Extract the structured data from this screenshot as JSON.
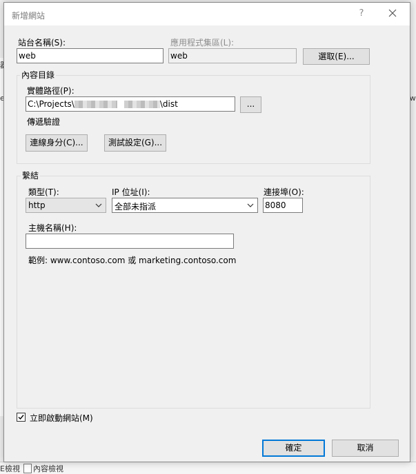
{
  "background": {
    "left_fragments": [
      "器",
      "ef"
    ],
    "right_fragment": "\\w",
    "bottom_left_text": "E檢視",
    "bottom_tab_text": "內容檢視"
  },
  "dialog": {
    "title": "新增網站",
    "help_label": "?",
    "site_name": {
      "label": "站台名稱(S):",
      "value": "web"
    },
    "app_pool": {
      "label": "應用程式集區(L):",
      "value": "web",
      "select_button": "選取(E)..."
    },
    "content_dir": {
      "group_title": "內容目錄",
      "physical_path_label": "實體路徑(P):",
      "path_prefix": "C:\\Projects\\",
      "path_suffix": "\\dist",
      "browse_button": "...",
      "pass_through_label": "傳遞驗證",
      "connect_as_button": "連線身分(C)...",
      "test_settings_button": "測試設定(G)..."
    },
    "binding": {
      "group_title": "繫結",
      "type_label": "類型(T):",
      "type_value": "http",
      "ip_label": "IP 位址(I):",
      "ip_value": "全部未指派",
      "port_label": "連接埠(O):",
      "port_value": "8080",
      "host_label": "主機名稱(H):",
      "host_value": "",
      "example_text": "範例: www.contoso.com 或 marketing.contoso.com"
    },
    "start_immediately": {
      "label": "立即啟動網站(M)",
      "checked": true
    },
    "ok_button": "確定",
    "cancel_button": "取消"
  }
}
